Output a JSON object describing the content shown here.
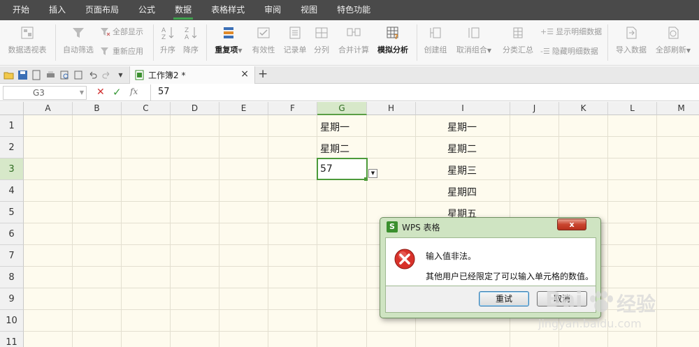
{
  "menu": [
    "开始",
    "插入",
    "页面布局",
    "公式",
    "数据",
    "表格样式",
    "审阅",
    "视图",
    "特色功能"
  ],
  "menu_active_index": 4,
  "ribbon": {
    "pivot": "数据透视表",
    "auto_filter": "自动筛选",
    "show_all": "全部显示",
    "reapply": "重新应用",
    "sort_asc": "升序",
    "sort_desc": "降序",
    "duplicates": "重复项",
    "validation": "有效性",
    "record_form": "记录单",
    "split": "分列",
    "consolidate": "合并计算",
    "what_if": "模拟分析",
    "group": "创建组",
    "ungroup": "取消组合",
    "subtotal": "分类汇总",
    "show_detail": "显示明细数据",
    "hide_detail": "隐藏明细数据",
    "import": "导入数据",
    "refresh_all": "全部刷新"
  },
  "doc_tab": {
    "name": "工作簿2 *",
    "close": "×",
    "new": "+"
  },
  "formula_bar": {
    "name_box": "G3",
    "fx": "fx",
    "value": "57"
  },
  "columns": [
    "A",
    "B",
    "C",
    "D",
    "E",
    "F",
    "G",
    "H",
    "I",
    "J",
    "K",
    "L",
    "M"
  ],
  "rows": [
    "1",
    "2",
    "3",
    "4",
    "5",
    "6",
    "7",
    "8",
    "9",
    "10",
    "11"
  ],
  "cells": {
    "G1": "星期一",
    "G2": "星期二",
    "G3": "57",
    "I1": "星期一",
    "I2": "星期二",
    "I3": "星期三",
    "I4": "星期四",
    "I5": "星期五"
  },
  "dialog": {
    "title": "WPS 表格",
    "app_icon": "S",
    "close": "x",
    "message1": "输入值非法。",
    "message2": "其他用户已经限定了可以输入单元格的数值。",
    "retry": "重试",
    "cancel": "取消"
  },
  "watermark": {
    "brand": "Bai",
    "brand2": "经验",
    "url": "jingyan.baidu.com"
  },
  "colors": {
    "menu_bg": "#4a4a4a",
    "accent_green": "#3fa14e",
    "sheet_bg": "#fefbee",
    "dialog_frame": "#cfe4c2"
  }
}
